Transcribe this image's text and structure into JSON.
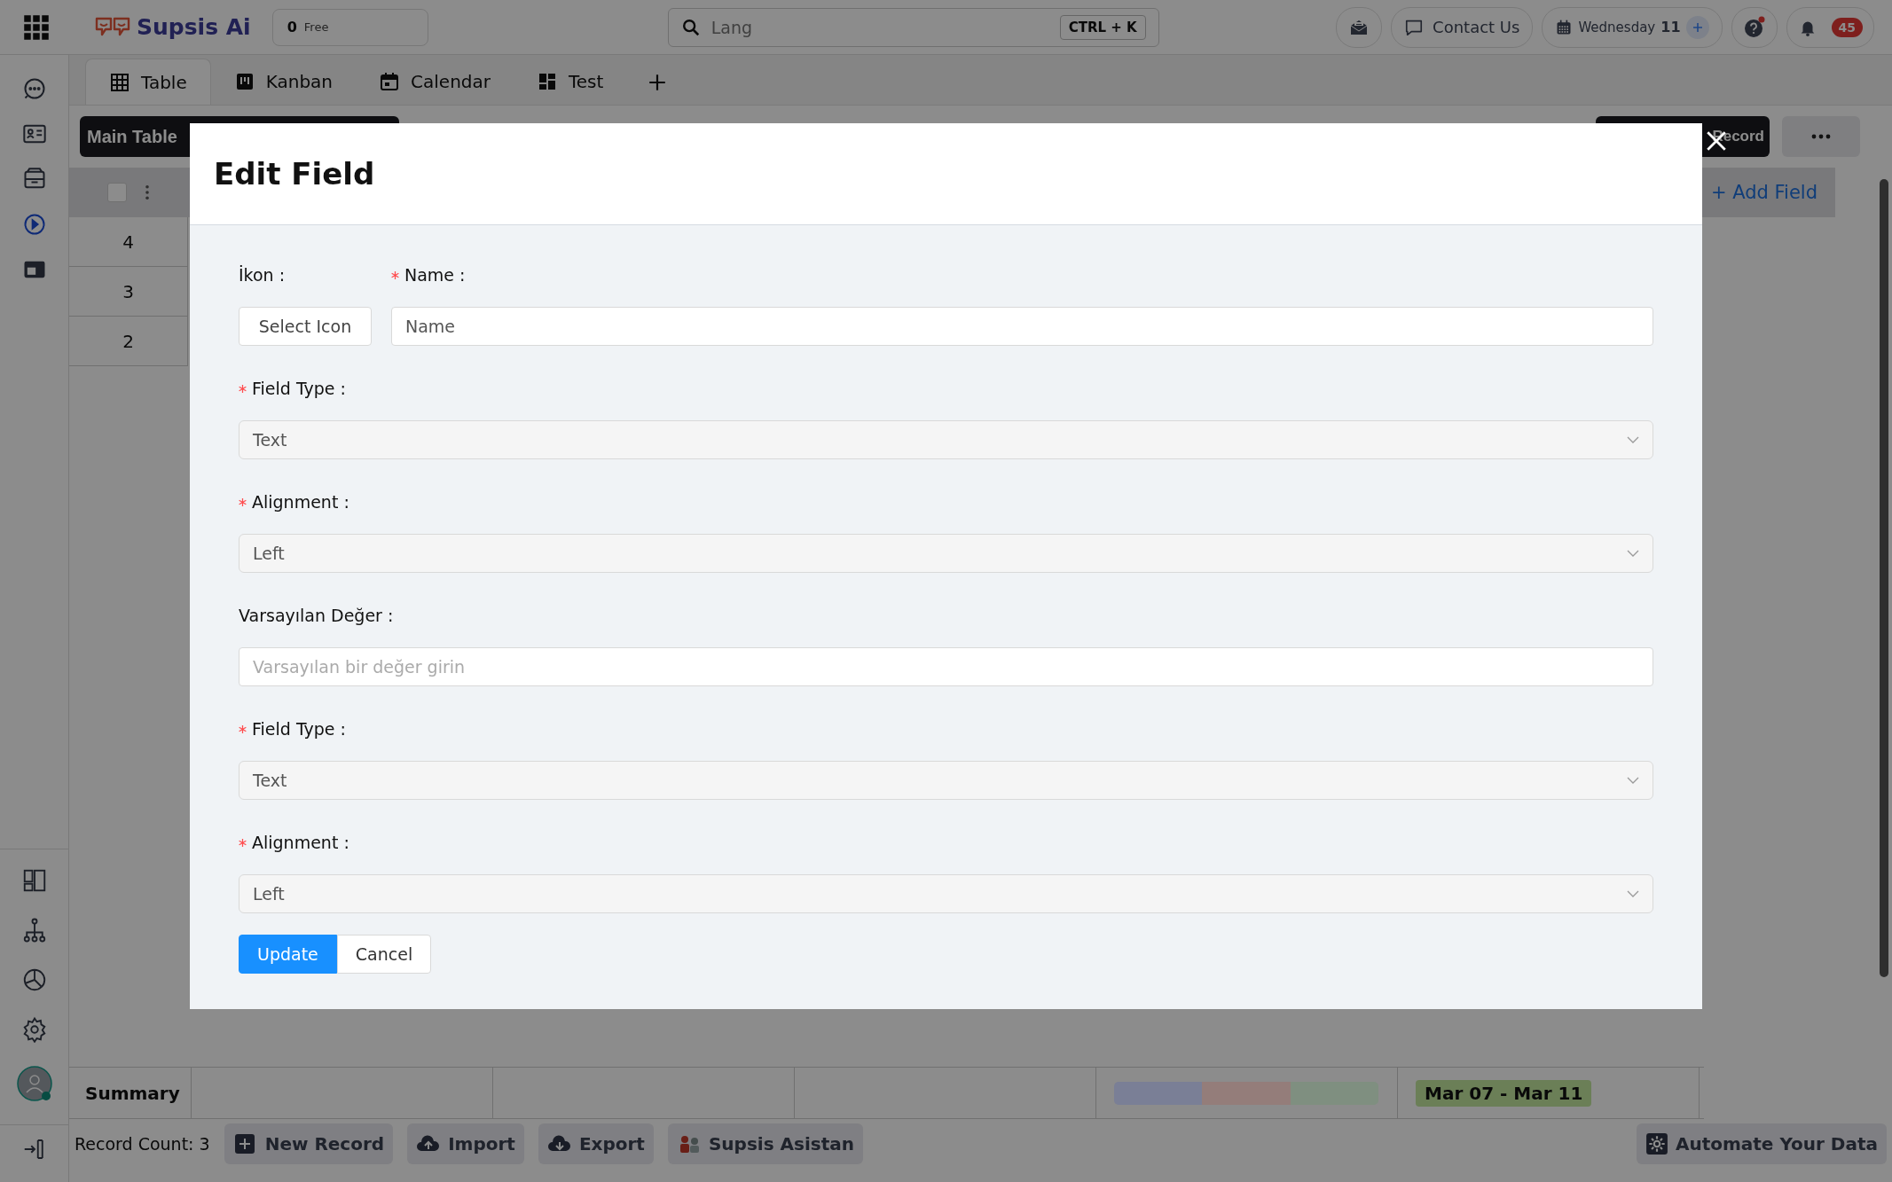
{
  "topbar": {
    "brand": "Supsis Ai",
    "credits": {
      "count": "0",
      "label": "Free"
    },
    "search": {
      "placeholder": "Lang",
      "shortcut": "CTRL + K"
    },
    "contact": "Contact Us",
    "date": {
      "day": "Wednesday",
      "number": "11"
    },
    "notifications": "45"
  },
  "sidebar": {
    "top_items": [
      {
        "selected": false
      },
      {
        "selected": false
      },
      {
        "selected": false
      },
      {
        "selected": true
      },
      {
        "selected": false
      }
    ]
  },
  "tabs": [
    {
      "label": "Table",
      "selected": true
    },
    {
      "label": "Kanban",
      "selected": false
    },
    {
      "label": "Calendar",
      "selected": false
    },
    {
      "label": "Test",
      "selected": false
    }
  ],
  "toolbar": {
    "table_name": "Main Table",
    "record_button": "Record"
  },
  "table": {
    "select_all": {
      "checked": false
    },
    "add_field": "+ Add Field",
    "rows": [
      "4",
      "3",
      "2"
    ]
  },
  "summary": {
    "label": "Summary",
    "progress_segments": [
      {
        "color": "#7a7f96"
      },
      {
        "color": "#947d7a"
      },
      {
        "color": "#7f8f80"
      }
    ],
    "date_range": "Mar 07 - Mar 11"
  },
  "bottom_bar": {
    "record_count": "Record Count: 3",
    "actions": [
      "New Record",
      "Import",
      "Export",
      "Supsis Asistan"
    ],
    "automate": "Automate Your Data"
  },
  "modal": {
    "title": "Edit Field",
    "icon_field": {
      "label": "İkon :",
      "button": "Select Icon"
    },
    "name_field": {
      "label": "Name :",
      "required": true,
      "placeholder": "Name"
    },
    "fields": [
      {
        "kind": "select",
        "label": "Field Type :",
        "required": true,
        "value": "Text"
      },
      {
        "kind": "select",
        "label": "Alignment :",
        "required": true,
        "value": "Left"
      },
      {
        "kind": "input",
        "label": "Varsayılan Değer :",
        "required": false,
        "placeholder": "Varsayılan bir değer girin"
      },
      {
        "kind": "select",
        "label": "Field Type :",
        "required": true,
        "value": "Text"
      },
      {
        "kind": "select",
        "label": "Alignment :",
        "required": true,
        "value": "Left"
      }
    ],
    "buttons": [
      {
        "label": "Update",
        "kind": "primary"
      },
      {
        "label": "Cancel",
        "kind": "default"
      }
    ]
  }
}
